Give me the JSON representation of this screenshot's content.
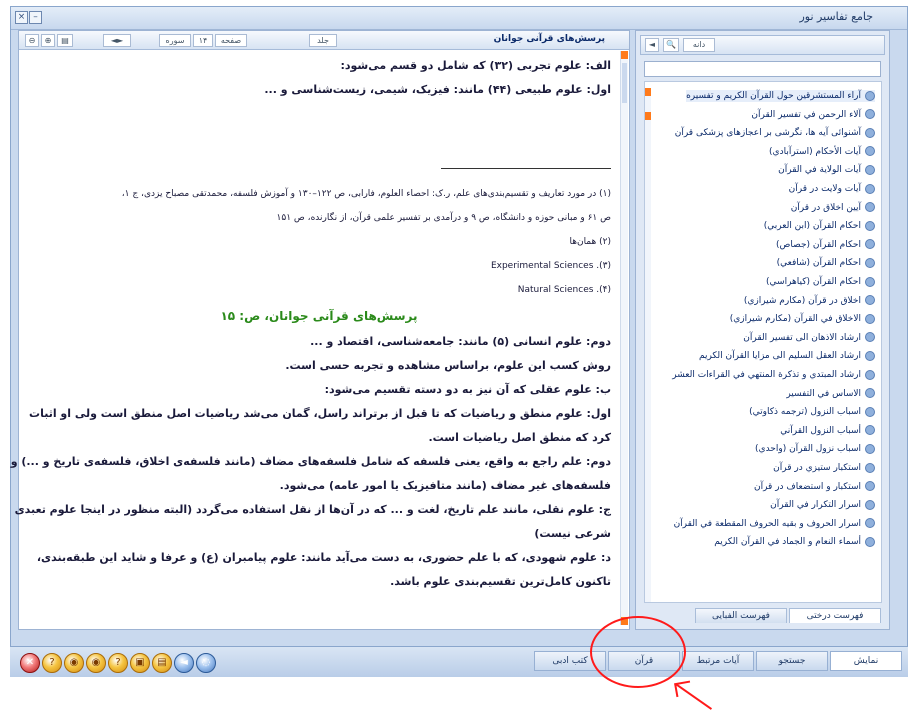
{
  "window": {
    "title": "جامع تفاسیر نور"
  },
  "right_panel": {
    "toolbar": {
      "btn1": "◄",
      "btn2": "🔍",
      "btn3": "دانه"
    },
    "search_value": "",
    "tree_items": [
      "آراء المستشرقين حول القرآن الكريم و تفسيره",
      "آلاء الرحمن في تفسير القرآن",
      "آشنوائی آیه ها، نگرشی بر اعجازهای پزشکی قرآن",
      "آيات الأحكام (استرآبادي)",
      "آيات الولاية في القرآن",
      "آيات ولايت در قرآن",
      "آيين اخلاق در قرآن",
      "احكام القرآن (ابن العربي)",
      "احكام القرآن (جصاص)",
      "احكام القرآن (شافعي)",
      "احكام القرآن (كياهراسي)",
      "اخلاق در قرآن (مكارم شيرازي)",
      "الاخلاق في القرآن (مكارم شيرازي)",
      "ارشاد الاذهان الى تفسير القرآن",
      "ارشاد العقل السليم الى مزايا القرآن الكريم",
      "ارشاد المبتدي و تذكرة المنتهي في القراءات العشر",
      "الاساس في التفسير",
      "اسباب النزول (ترجمه ذكاوتي)",
      "أسباب النزول القرآني",
      "اسباب نزول القرآن (واحدي)",
      "استكبار ستيزي در قرآن",
      "استكبار و استضعاف در قرآن",
      "اسرار التكرار في القرآن",
      "اسرار الحروف و بقيه الحروف المقطعة في القرآن",
      "أسماء النعام و الجماد في القرآن الكريم"
    ],
    "tabs": {
      "tab1": "فهرست درختی",
      "tab2": "فهرست الفبایی"
    }
  },
  "left_panel": {
    "title": "پرسش‌های قرآنی جوانان",
    "toolbar": {
      "page_label": "صفحه",
      "page_value": "۱۴",
      "surah_label": "سوره",
      "jild": "جلد"
    },
    "lines": {
      "l1": "الف: علوم تجربی (۳۲) که شامل دو قسم می‌شود:",
      "l2": "اول: علوم طبیعی (۴۴) مانند: فیزیک، شیمی، زیست‌شناسی و ...",
      "fn1": "(۱) در مورد تعاریف و تقسیم‌بندی‌های علم، ر.ک: احصاء العلوم، فارابی، ص ۱۲۲–۱۳۰ و آموزش فلسفه، محمدتقی مصباح یزدی، ج ۱،",
      "fn2": "ص ۶۱ و مبانی حوزه و دانشگاه، ص ۹ و درآمدی بر تفسیر علمی قرآن، از نگارنده، ص ۱۵۱",
      "fn3": "(۲) همان‌ها",
      "fn4": "Experimental Sciences .(۳)",
      "fn5": "Natural Sciences .(۴)",
      "heading": "پرسش‌های قرآنی جوانان، ص: ۱۵",
      "p1": "دوم: علوم انسانی (۵) مانند: جامعه‌شناسی، اقتصاد و ...",
      "p2": "روش کسب این علوم، براساس مشاهده و تجربه حسی است.",
      "p3": "ب: علوم عقلی که آن نیز به دو دسته تقسیم می‌شود:",
      "p4": "اول: علوم منطق و ریاضیات که تا قبل از برتراند راسل، گمان می‌شد ریاضیات اصل منطق است ولی او اثبات",
      "p5": "کرد که منطق اصل ریاضیات است.",
      "p6": "دوم: علم راجع به واقع، یعنی فلسفه که شامل فلسفه‌های مضاف (مانند فلسفه‌ی اخلاق، فلسفه‌ی تاریخ و ...) و",
      "p7": "فلسفه‌های غیر مضاف (مانند متافیزیک یا امور عامه) می‌شود.",
      "p8": "ج: علوم نقلی، مانند علم تاریخ، لغت و ... که در آن‌ها از نقل استفاده می‌گردد (البته منظور در اینجا علوم تعبدی",
      "p9": "شرعی نیست)",
      "p10": "د: علوم شهودی، که با علم حضوری، به دست می‌آید مانند: علوم پیامبران (ع) و عرفا و شاید این طبقه‌بندی،",
      "p11": "تاکنون کامل‌ترین تقسیم‌بندی علوم باشد."
    }
  },
  "bottom_bar": {
    "buttons": [
      "✕",
      "?",
      "◉",
      "◉",
      "?",
      "▣",
      "▤",
      "◄",
      "◌"
    ],
    "tabs": [
      "نمایش",
      "جستجو",
      "آیات مرتبط",
      "قرآن",
      "کتب ادبی"
    ]
  }
}
